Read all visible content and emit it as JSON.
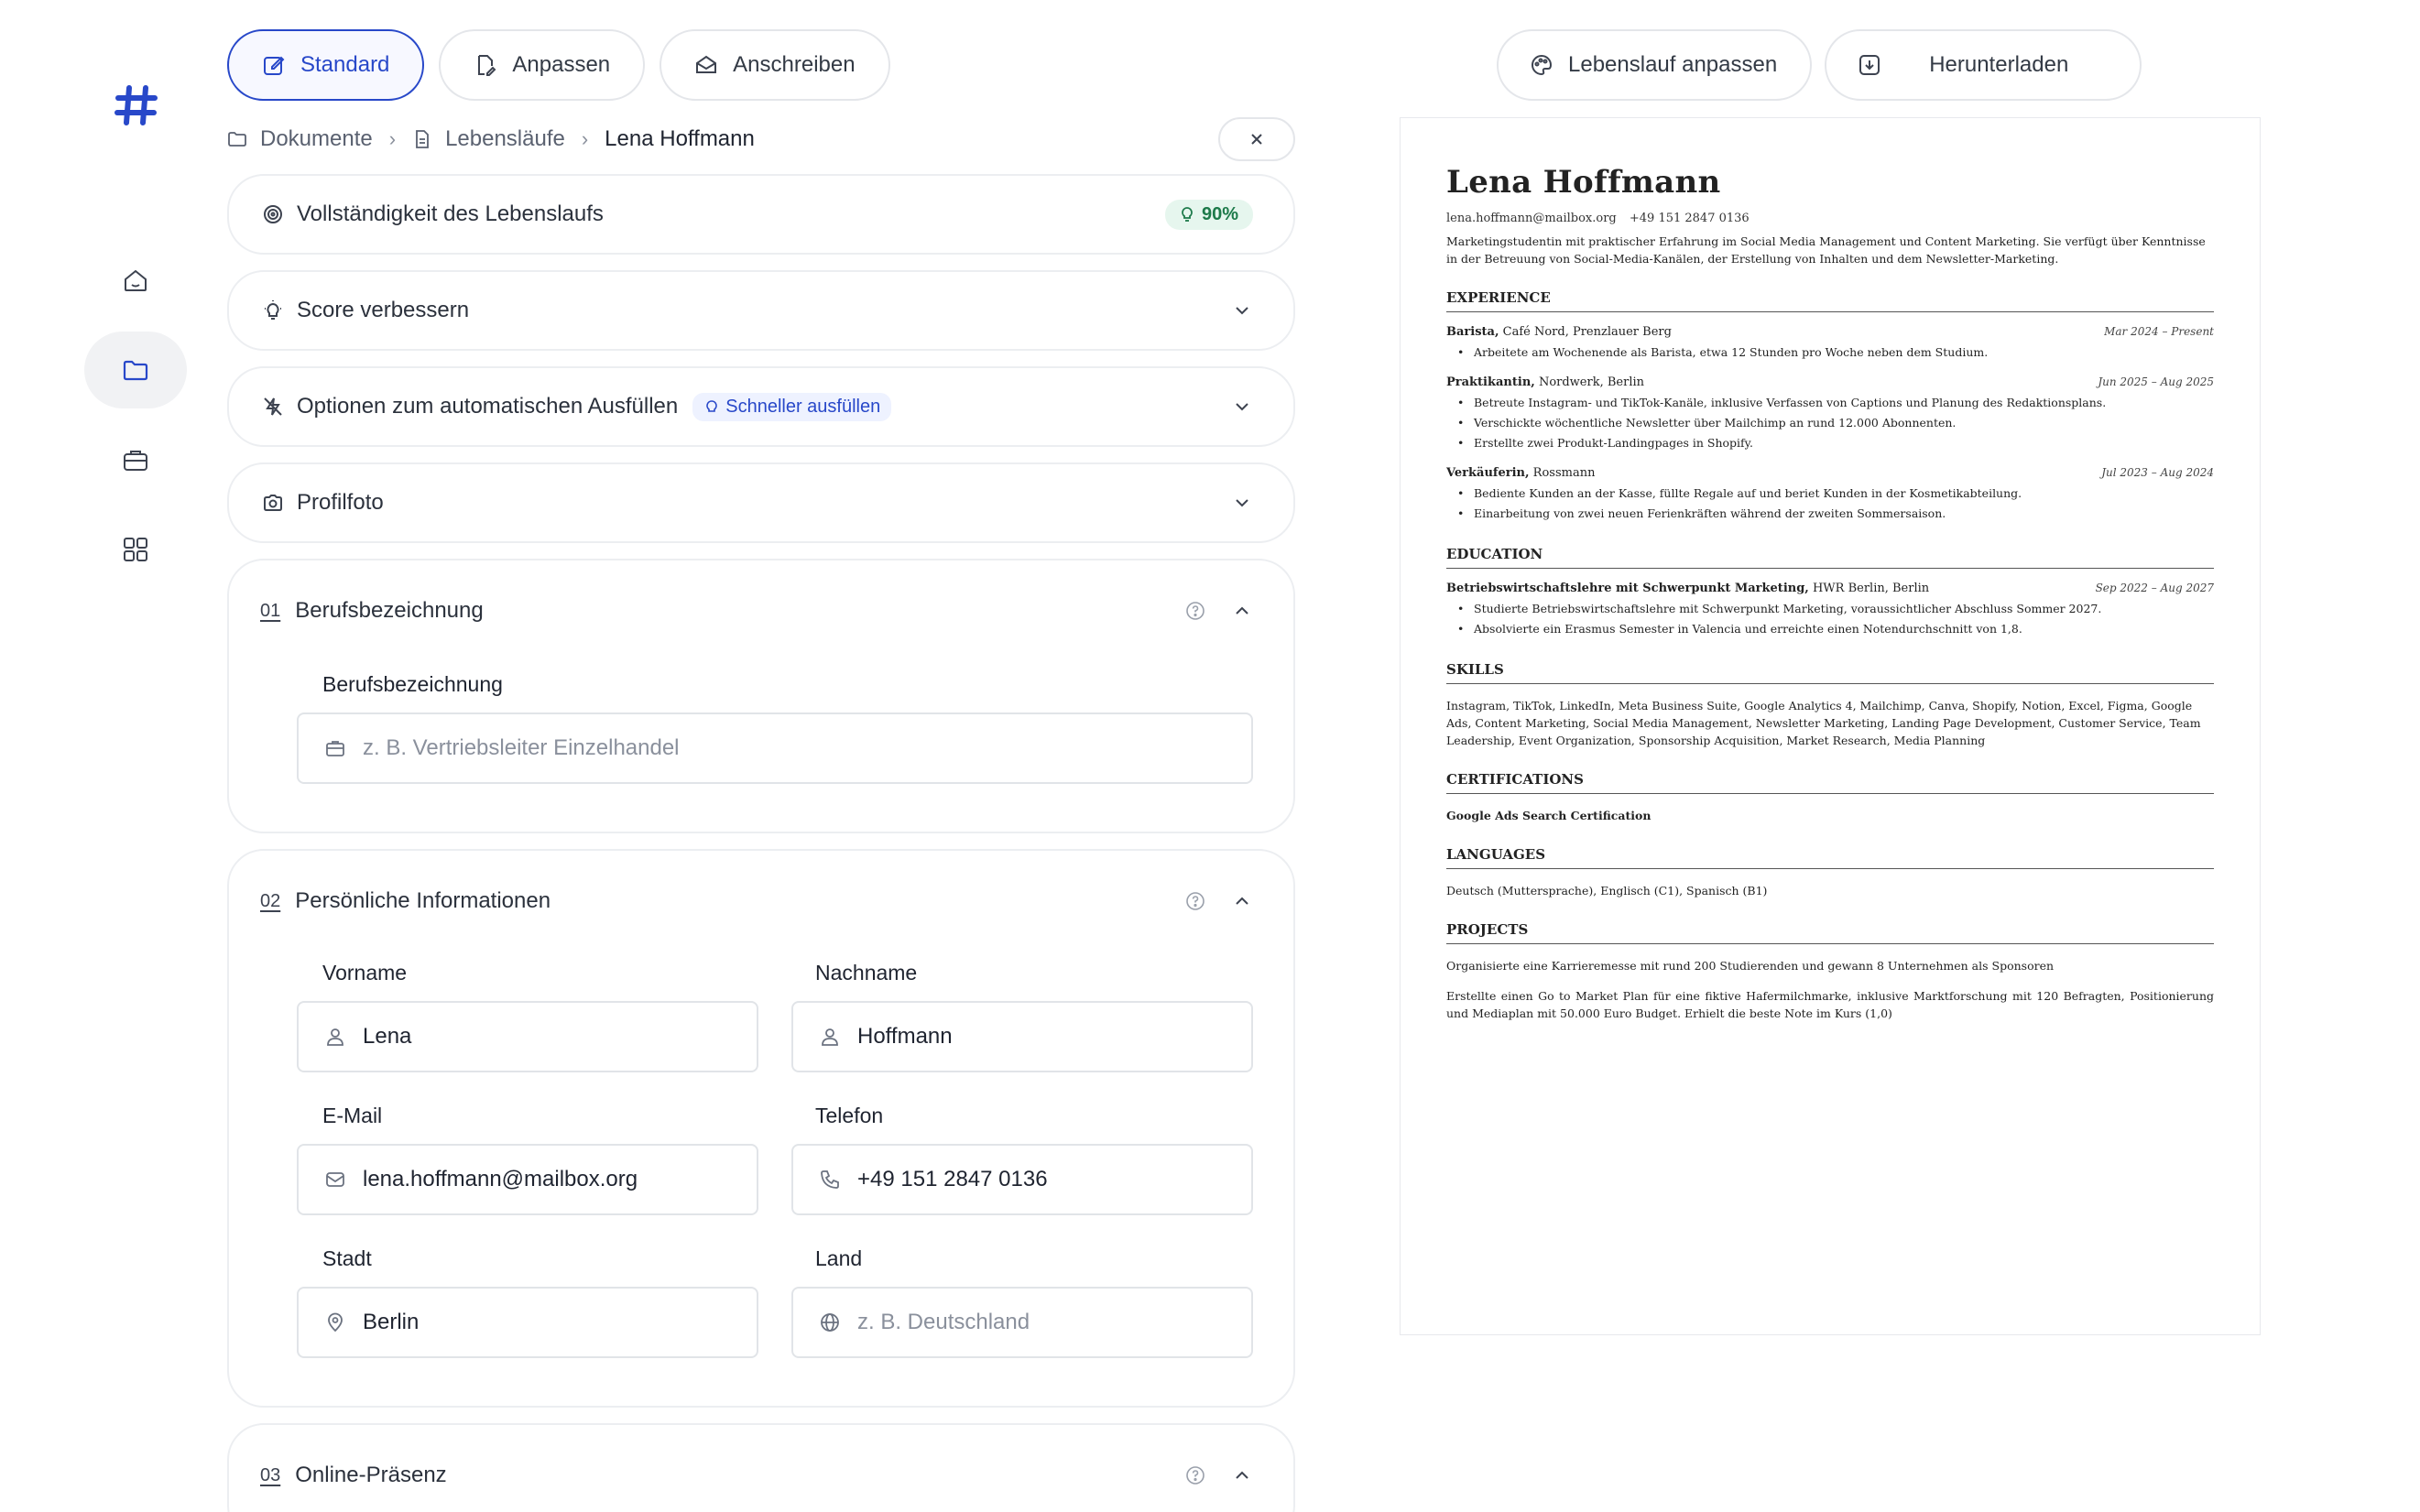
{
  "tabs": [
    {
      "label": "Standard"
    },
    {
      "label": "Anpassen"
    },
    {
      "label": "Anschreiben"
    }
  ],
  "top_actions": {
    "customize": "Lebenslauf anpassen",
    "download": "Herunterladen"
  },
  "breadcrumb": {
    "root": "Dokumente",
    "folder": "Lebensläufe",
    "current": "Lena Hoffmann"
  },
  "completeness": {
    "label": "Vollständigkeit des Lebenslaufs",
    "percent": "90%"
  },
  "score": {
    "label": "Score verbessern"
  },
  "autofill": {
    "label": "Optionen zum automatischen Ausfüllen",
    "tag": "Schneller ausfüllen"
  },
  "photo": {
    "label": "Profilfoto"
  },
  "section1": {
    "num": "01",
    "title": "Berufsbezeichnung",
    "field_label": "Berufsbezeichnung",
    "placeholder": "z. B. Vertriebsleiter Einzelhandel"
  },
  "section2": {
    "num": "02",
    "title": "Persönliche Informationen",
    "first_label": "Vorname",
    "first": "Lena",
    "last_label": "Nachname",
    "last": "Hoffmann",
    "email_label": "E-Mail",
    "email": "lena.hoffmann@mailbox.org",
    "phone_label": "Telefon",
    "phone": "+49 151 2847 0136",
    "city_label": "Stadt",
    "city": "Berlin",
    "country_label": "Land",
    "country_placeholder": "z. B. Deutschland"
  },
  "section3": {
    "num": "03",
    "title": "Online-Präsenz"
  },
  "resume": {
    "name": "Lena Hoffmann",
    "email": "lena.hoffmann@mailbox.org",
    "phone": "+49 151 2847 0136",
    "summary": "Marketingstudentin mit praktischer Erfahrung im Social Media Management und Content Marketing. Sie verfügt über Kenntnisse in der Betreuung von Social-Media-Kanälen, der Erstellung von Inhalten und dem Newsletter-Marketing.",
    "exp_title": "EXPERIENCE",
    "jobs": [
      {
        "role": "Barista,",
        "org": " Café Nord, Prenzlauer Berg",
        "date": "Mar 2024 – Present",
        "bullets": [
          "Arbeitete am Wochenende als Barista, etwa 12 Stunden pro Woche neben dem Studium."
        ]
      },
      {
        "role": "Praktikantin,",
        "org": " Nordwerk, Berlin",
        "date": "Jun 2025 – Aug 2025",
        "bullets": [
          "Betreute Instagram- und TikTok-Kanäle, inklusive Verfassen von Captions und Planung des Redaktionsplans.",
          "Verschickte wöchentliche Newsletter über Mailchimp an rund 12.000 Abonnenten.",
          "Erstellte zwei Produkt-Landingpages in Shopify."
        ]
      },
      {
        "role": "Verkäuferin,",
        "org": " Rossmann",
        "date": "Jul 2023 – Aug 2024",
        "bullets": [
          "Bediente Kunden an der Kasse, füllte Regale auf und beriet Kunden in der Kosmetikabteilung.",
          "Einarbeitung von zwei neuen Ferienkräften während der zweiten Sommersaison."
        ]
      }
    ],
    "edu_title": "EDUCATION",
    "edu": {
      "degree": "Betriebswirtschaftslehre mit Schwerpunkt Marketing,",
      "org": " HWR Berlin, Berlin",
      "date": "Sep 2022 – Aug 2027",
      "bullets": [
        "Studierte Betriebswirtschaftslehre mit Schwerpunkt Marketing, voraussichtlicher Abschluss Sommer 2027.",
        "Absolvierte ein Erasmus Semester in Valencia und erreichte einen Notendurchschnitt von 1,8."
      ]
    },
    "skills_title": "SKILLS",
    "skills": "Instagram, TikTok, LinkedIn, Meta Business Suite, Google Analytics 4, Mailchimp, Canva, Shopify, Notion, Excel, Figma, Google Ads, Content Marketing, Social Media Management, Newsletter Marketing, Landing Page Development, Customer Service, Team Leadership, Event Organization, Sponsorship Acquisition, Market Research, Media Planning",
    "cert_title": "CERTIFICATIONS",
    "cert": "Google Ads Search Certification",
    "lang_title": "LANGUAGES",
    "languages": "Deutsch (Muttersprache), Englisch (C1), Spanisch (B1)",
    "proj_title": "PROJECTS",
    "projects": [
      "Organisierte eine Karrieremesse mit rund 200 Studierenden und gewann 8 Unternehmen als Sponsoren",
      "Erstellte einen Go to Market Plan für eine fiktive Hafermilchmarke, inklusive Marktforschung mit 120 Befragten, Positionierung und Mediaplan mit 50.000 Euro Budget. Erhielt die beste Note im Kurs (1,0)"
    ]
  }
}
